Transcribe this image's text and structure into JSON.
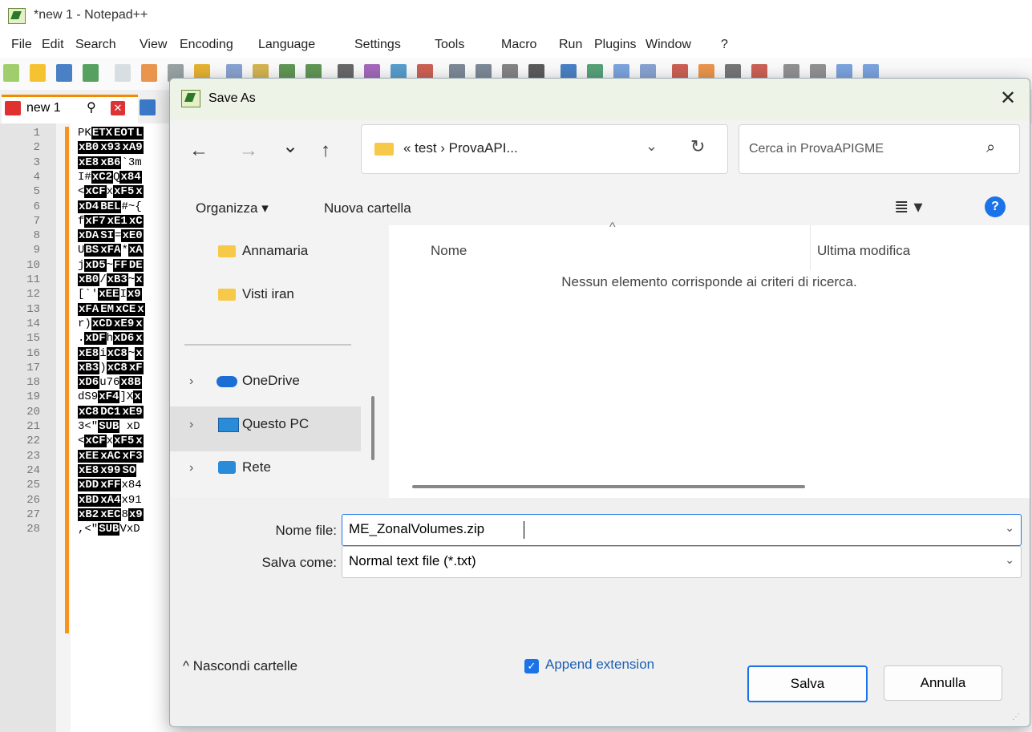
{
  "app": {
    "title": "*new 1 - Notepad++",
    "menu": [
      "File",
      "Edit",
      "Search",
      "View",
      "Encoding",
      "Language",
      "Settings",
      "Tools",
      "Macro",
      "Run",
      "Plugins",
      "Window",
      "?"
    ],
    "tab_label": "new 1",
    "line_numbers": [
      "1",
      "2",
      "3",
      "4",
      "5",
      "6",
      "7",
      "8",
      "9",
      "10",
      "11",
      "12",
      "13",
      "14",
      "15",
      "16",
      "17",
      "18",
      "19",
      "20",
      "21",
      "22",
      "23",
      "24",
      "25",
      "26",
      "27",
      "28"
    ],
    "code_lines": [
      [
        [
          "t",
          "PK"
        ],
        [
          "b",
          "ETX"
        ],
        [
          "b",
          "EOT"
        ],
        [
          "b",
          "L"
        ]
      ],
      [
        [
          "b",
          "xB0"
        ],
        [
          "b",
          "x93"
        ],
        [
          "b",
          "xA9"
        ]
      ],
      [
        [
          "b",
          "xE8"
        ],
        [
          "b",
          "xB6"
        ],
        [
          "t",
          "`3m"
        ]
      ],
      [
        [
          "t",
          "I#"
        ],
        [
          "b",
          "xC2"
        ],
        [
          "t",
          "Q"
        ],
        [
          "b",
          "x84"
        ]
      ],
      [
        [
          "t",
          "<"
        ],
        [
          "b",
          "xCF"
        ],
        [
          "t",
          "x"
        ],
        [
          "b",
          "xF5"
        ],
        [
          "b",
          "x"
        ]
      ],
      [
        [
          "b",
          "xD4"
        ],
        [
          "b",
          "BEL"
        ],
        [
          "t",
          "#~{"
        ]
      ],
      [
        [
          "t",
          "f"
        ],
        [
          "b",
          "xF7"
        ],
        [
          "b",
          "xE1"
        ],
        [
          "b",
          "xC"
        ]
      ],
      [
        [
          "b",
          "xDA"
        ],
        [
          "b",
          "SI"
        ],
        [
          "t",
          "="
        ],
        [
          "b",
          "xE0"
        ]
      ],
      [
        [
          "t",
          "U"
        ],
        [
          "b",
          "BS"
        ],
        [
          "b",
          "xFA"
        ],
        [
          "t",
          "*"
        ],
        [
          "b",
          "xA"
        ]
      ],
      [
        [
          "t",
          "j"
        ],
        [
          "b",
          "xD5"
        ],
        [
          "t",
          "~"
        ],
        [
          "b",
          "FF"
        ],
        [
          "b",
          "DE"
        ]
      ],
      [
        [
          "b",
          "xB0"
        ],
        [
          "t",
          "/"
        ],
        [
          "b",
          "xB3"
        ],
        [
          "t",
          "~"
        ],
        [
          "b",
          "x"
        ]
      ],
      [
        [
          "t",
          "[`'"
        ],
        [
          "b",
          "xEE"
        ],
        [
          "t",
          "I"
        ],
        [
          "b",
          "x9"
        ]
      ],
      [
        [
          "b",
          "xFA"
        ],
        [
          "b",
          "EM"
        ],
        [
          "b",
          "xCE"
        ],
        [
          "b",
          "x"
        ]
      ],
      [
        [
          "t",
          "r)"
        ],
        [
          "b",
          "xCD"
        ],
        [
          "b",
          "xE9"
        ],
        [
          "b",
          "x"
        ]
      ],
      [
        [
          "t",
          "."
        ],
        [
          "b",
          "xDF"
        ],
        [
          "t",
          "h"
        ],
        [
          "b",
          "xD6"
        ],
        [
          "b",
          "x"
        ]
      ],
      [
        [
          "b",
          "xE8"
        ],
        [
          "t",
          "i"
        ],
        [
          "b",
          "xC8"
        ],
        [
          "t",
          "~"
        ],
        [
          "b",
          "x"
        ]
      ],
      [
        [
          "b",
          "xB3"
        ],
        [
          "t",
          ")"
        ],
        [
          "b",
          "xC8"
        ],
        [
          "b",
          "xF"
        ]
      ],
      [
        [
          "b",
          "xD6"
        ],
        [
          "t",
          "u76"
        ],
        [
          "b",
          "x8B"
        ]
      ],
      [
        [
          "t",
          "dS9"
        ],
        [
          "b",
          "xF4"
        ],
        [
          "t",
          "]X"
        ],
        [
          "b",
          "x"
        ]
      ],
      [
        [
          "b",
          "xC8"
        ],
        [
          "b",
          "DC1"
        ],
        [
          "b",
          "xE9"
        ]
      ],
      [
        [
          "t",
          "3<\""
        ],
        [
          "b",
          "SUB"
        ],
        [
          "t",
          " xD"
        ]
      ],
      [
        [
          "t",
          "<"
        ],
        [
          "b",
          "xCF"
        ],
        [
          "t",
          "x"
        ],
        [
          "b",
          "xF5"
        ],
        [
          "b",
          "x"
        ]
      ],
      [
        [
          "b",
          "xEE"
        ],
        [
          "b",
          "xAC"
        ],
        [
          "b",
          "xF3"
        ]
      ],
      [
        [
          "b",
          "xE8"
        ],
        [
          "b",
          "x99"
        ],
        [
          "b",
          "SO"
        ]
      ],
      [
        [
          "b",
          "xDD"
        ],
        [
          "b",
          "xFF"
        ],
        [
          "t",
          "x84"
        ]
      ],
      [
        [
          "b",
          "xBD"
        ],
        [
          "b",
          "xA4"
        ],
        [
          "t",
          "x91"
        ]
      ],
      [
        [
          "b",
          "xB2"
        ],
        [
          "b",
          "xEC"
        ],
        [
          "t",
          "8"
        ],
        [
          "b",
          "x9"
        ]
      ],
      [
        [
          "t",
          ",<\""
        ],
        [
          "b",
          "SUB"
        ],
        [
          "t",
          "VxD"
        ]
      ]
    ]
  },
  "dialog": {
    "title": "Save As",
    "close": "✕",
    "nav": {
      "back": "←",
      "forward": "→",
      "recent": "⌄",
      "up": "↑"
    },
    "address": {
      "crumbs": "«  test  ›  ProvaAPI...",
      "chevron": "⌄",
      "refresh": "↻"
    },
    "search": {
      "placeholder": "Cerca in ProvaAPIGME",
      "icon": "⌕"
    },
    "commands": {
      "organize": "Organizza ▾",
      "new_folder": "Nuova cartella",
      "view_icon": "≣ ▾",
      "help": "?"
    },
    "nav_pane": {
      "folders": [
        {
          "label": "Annamaria"
        },
        {
          "label": "Visti iran"
        }
      ],
      "locations": [
        {
          "label": "OneDrive"
        },
        {
          "label": "Questo PC",
          "selected": true
        },
        {
          "label": "Rete"
        }
      ]
    },
    "list": {
      "col_name": "Nome",
      "col_modified": "Ultima modifica",
      "sort_indicator": "^",
      "empty_message": "Nessun elemento corrisponde ai criteri di ricerca."
    },
    "filename_label": "Nome file:",
    "filename_value": "ME_ZonalVolumes.zip",
    "savetype_label": "Salva come:",
    "savetype_value": "Normal text file (*.txt)",
    "hide_folders": "^  Nascondi cartelle",
    "append_extension": {
      "label": "Append extension",
      "checked": true
    },
    "save_button": "Salva",
    "cancel_button": "Annulla"
  }
}
